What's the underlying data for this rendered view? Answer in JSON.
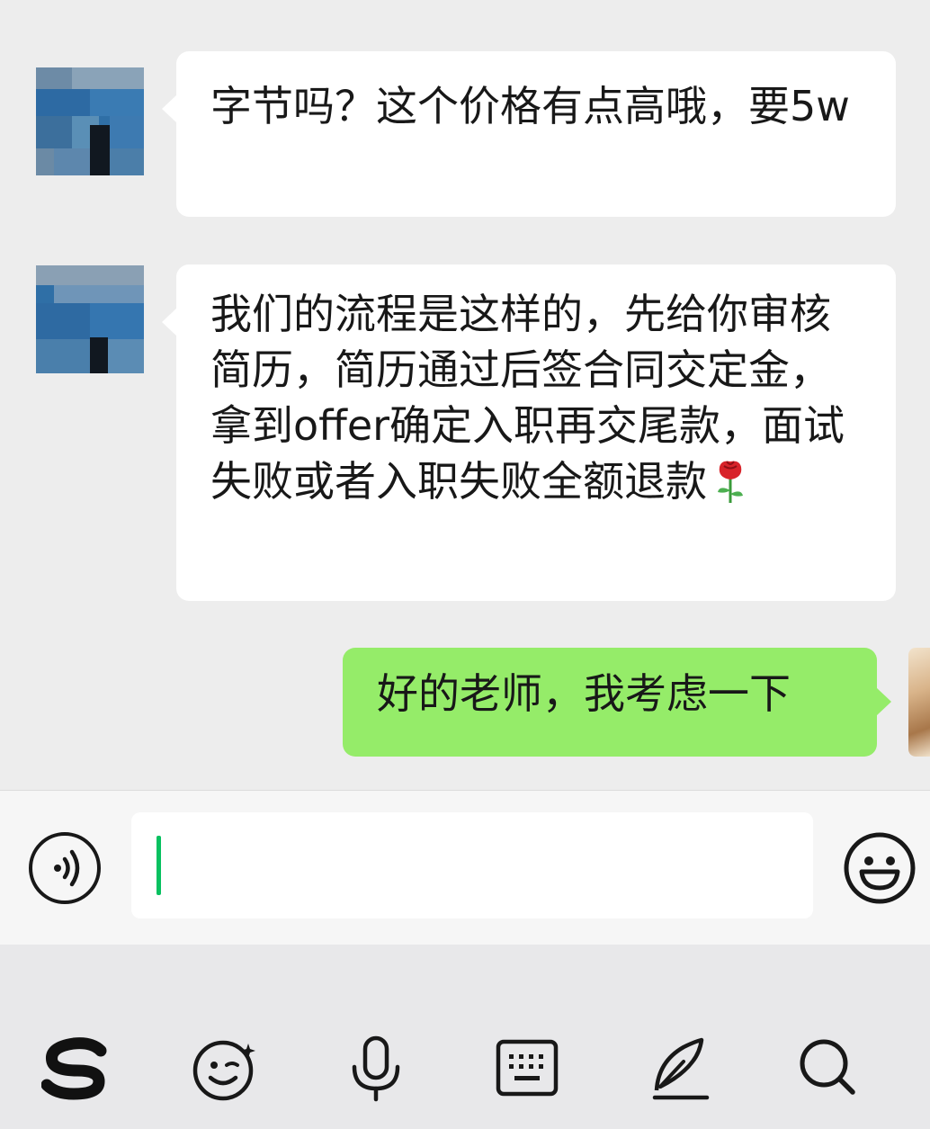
{
  "messages": [
    {
      "side": "left",
      "text": "字节吗？这个价格有点高哦，要5w"
    },
    {
      "side": "left",
      "text": "我们的流程是这样的，先给你审核简历，简历通过后签合同交定金，拿到offer确定入职再交尾款，面试失败或者入职失败全额退款"
    },
    {
      "side": "right",
      "text": "好的老师，我考虑一下"
    }
  ],
  "icons": {
    "rose": "rose-emoji",
    "voice": "voice-icon",
    "emoji": "emoji-icon",
    "toolbar": [
      "sogou-logo-icon",
      "wink-emoji-icon",
      "microphone-icon",
      "keyboard-icon",
      "handwriting-pen-icon",
      "search-icon"
    ]
  },
  "colors": {
    "chat_background": "#ededed",
    "incoming_bubble": "#ffffff",
    "outgoing_bubble": "#95ec69",
    "caret": "#07c160"
  }
}
